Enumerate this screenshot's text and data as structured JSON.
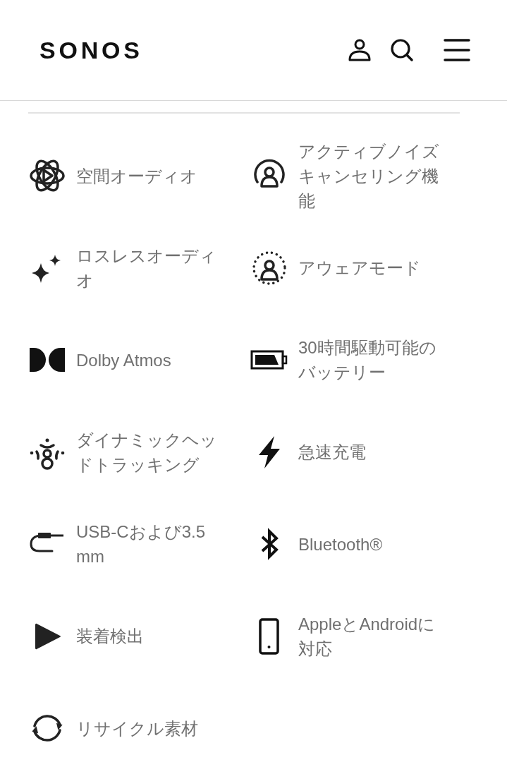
{
  "header": {
    "logo": "SONOS"
  },
  "feature_rows": [
    [
      {
        "kind": "spatial",
        "label": "空間オーディオ"
      },
      {
        "kind": "anc",
        "label": "アクティブノイズキャンセリング機能"
      }
    ],
    [
      {
        "kind": "lossless",
        "label": "ロスレスオーディオ"
      },
      {
        "kind": "aware",
        "label": "アウェアモード"
      }
    ],
    [
      {
        "kind": "dolby",
        "label": "Dolby Atmos"
      },
      {
        "kind": "battery",
        "label": "30時間駆動可能のバッテリー"
      }
    ],
    [
      {
        "kind": "headtracking",
        "label": "ダイナミックヘッドトラッキング"
      },
      {
        "kind": "charge",
        "label": "急速充電"
      }
    ],
    [
      {
        "kind": "cable",
        "label": "USB-Cおよび3.5 mm"
      },
      {
        "kind": "bluetooth",
        "label": "Bluetooth®"
      }
    ],
    [
      {
        "kind": "detection",
        "label": "装着検出"
      },
      {
        "kind": "phone",
        "label": "AppleとAndroidに対応"
      }
    ],
    [
      {
        "kind": "recycle",
        "label": "リサイクル素材"
      }
    ]
  ]
}
